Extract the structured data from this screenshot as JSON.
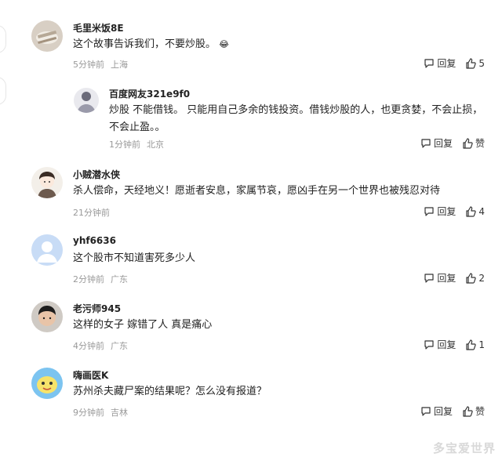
{
  "comments": [
    {
      "user": "毛里米饭8E",
      "text": "这个故事告诉我们，不要炒股。",
      "emoji": "😂",
      "time": "5分钟前",
      "location": "上海",
      "reply_label": "回复",
      "likes": "5"
    },
    {
      "user": "百度网友321e9f0",
      "text": "炒股 不能借钱。 只能用自己多余的钱投资。借钱炒股的人，也更贪婪，不会止损，不会止盈。。",
      "time": "1分钟前",
      "location": "北京",
      "reply_label": "回复",
      "likes": "赞"
    },
    {
      "user": "小贼潜水侠",
      "text": "杀人偿命，天经地义！愿逝者安息，家属节哀，愿凶手在另一个世界也被残忍对待",
      "time": "21分钟前",
      "location": "",
      "reply_label": "回复",
      "likes": "4"
    },
    {
      "user": "yhf6636",
      "text": "这个股市不知道害死多少人",
      "time": "2分钟前",
      "location": "广东",
      "reply_label": "回复",
      "likes": "2"
    },
    {
      "user": "老污师945",
      "text": "这样的女子 嫁错了人 真是痛心",
      "time": "4分钟前",
      "location": "广东",
      "reply_label": "回复",
      "likes": "1"
    },
    {
      "user": "嗨画医K",
      "text": "苏州杀夫藏尸案的结果呢？怎么没有报道？",
      "time": "9分钟前",
      "location": "吉林",
      "reply_label": "回复",
      "likes": "赞"
    }
  ],
  "watermark": "多宝爱世界",
  "colors": {
    "text": "#222222",
    "meta": "#999999",
    "accent": "#333333"
  }
}
